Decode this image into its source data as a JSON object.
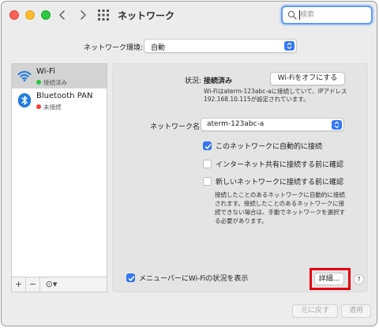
{
  "window": {
    "title": "ネットワーク"
  },
  "search": {
    "placeholder": "検索"
  },
  "location": {
    "label": "ネットワーク環境:",
    "value": "自動"
  },
  "sidebar": {
    "items": [
      {
        "name": "Wi-Fi",
        "status": "接続済み",
        "status_color": "#28c840",
        "icon": "wifi-icon",
        "selected": true
      },
      {
        "name": "Bluetooth PAN",
        "status": "未接続",
        "status_color": "#ff3b30",
        "icon": "bluetooth-icon",
        "selected": false
      }
    ],
    "tools": {
      "add": "+",
      "remove": "−",
      "more": "⊙▾"
    }
  },
  "detail": {
    "status_label": "状況:",
    "status_value": "接続済み",
    "wifi_off_button": "Wi-Fiをオフにする",
    "status_desc": "Wi-Fiはaterm-123abc-aに接続していて、IPアドレス 192.168.10.115が設定されています。",
    "network_name_label": "ネットワーク名:",
    "network_name_value": "aterm-123abc-a",
    "options": [
      {
        "label": "このネットワークに自動的に接続",
        "checked": true
      },
      {
        "label": "インターネット共有に接続する前に確認",
        "checked": false
      },
      {
        "label": "新しいネットワークに接続する前に確認",
        "checked": false
      }
    ],
    "ask_desc": "接続したことのあるネットワークに自動的に接続されます。接続したことのあるネットワークに接続できない場合は、手動でネットワークを選択する必要があります。",
    "menubar_label": "メニューバーにWi-Fiの状況を表示",
    "menubar_checked": true,
    "advanced_button": "詳細...",
    "help_button": "?"
  },
  "footer": {
    "revert_button": "元に戻す",
    "apply_button": "適用"
  },
  "colors": {
    "accent": "#3478f6",
    "highlight": "#e3000f",
    "connected": "#28c840",
    "disconnected": "#ff3b30"
  }
}
